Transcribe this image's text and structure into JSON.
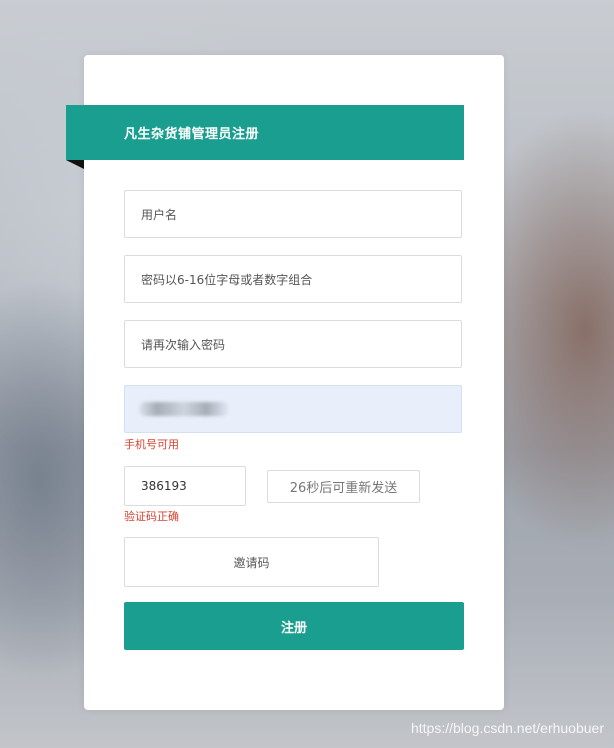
{
  "form": {
    "title": "凡生杂货铺管理员注册",
    "username_placeholder": "用户名",
    "password_placeholder": "密码以6-16位字母或者数字组合",
    "confirm_placeholder": "请再次输入密码",
    "phone_status": "手机号可用",
    "code_value": "386193",
    "send_code_label": "26秒后可重新发送",
    "code_status": "验证码正确",
    "invite_placeholder": "邀请码",
    "submit_label": "注册"
  },
  "watermark": "https://blog.csdn.net/erhuobuer",
  "colors": {
    "accent": "#1a9e8f",
    "error": "#d9412f",
    "phone_bg": "#e8effa"
  }
}
